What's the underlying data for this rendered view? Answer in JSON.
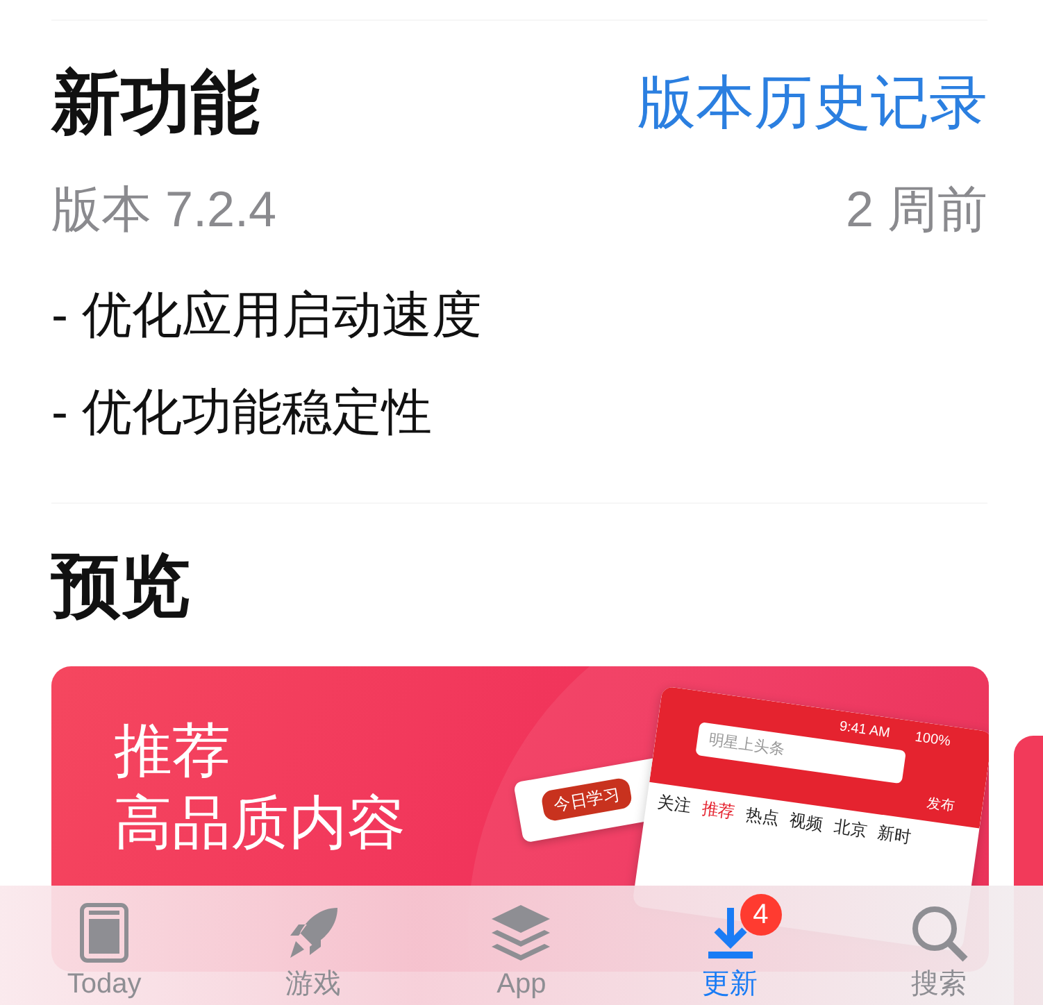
{
  "whats_new": {
    "title": "新功能",
    "history_link": "版本历史记录",
    "version": "版本 7.2.4",
    "date": "2 周前",
    "notes": [
      "- 优化应用启动速度",
      "- 优化功能稳定性"
    ]
  },
  "preview": {
    "title": "预览",
    "card": {
      "headline": "推荐",
      "subline": "高品质内容",
      "screenshot": {
        "time": "9:41 AM",
        "battery": "100%",
        "search_placeholder": "明星上头条",
        "channels": [
          {
            "label": "关注",
            "selected": false
          },
          {
            "label": "推荐",
            "selected": true
          },
          {
            "label": "热点",
            "selected": false
          },
          {
            "label": "视频",
            "selected": false
          },
          {
            "label": "北京",
            "selected": false
          },
          {
            "label": "新时",
            "selected": false
          }
        ],
        "post_label": "发布",
        "banner": "今日学习"
      }
    }
  },
  "tab_bar": [
    {
      "kind": "today",
      "label": "Today",
      "selected": false
    },
    {
      "kind": "games",
      "label": "游戏",
      "selected": false
    },
    {
      "kind": "apps",
      "label": "App",
      "selected": false
    },
    {
      "kind": "updates",
      "label": "更新",
      "selected": true,
      "badge": "4"
    },
    {
      "kind": "search",
      "label": "搜索",
      "selected": false
    }
  ]
}
